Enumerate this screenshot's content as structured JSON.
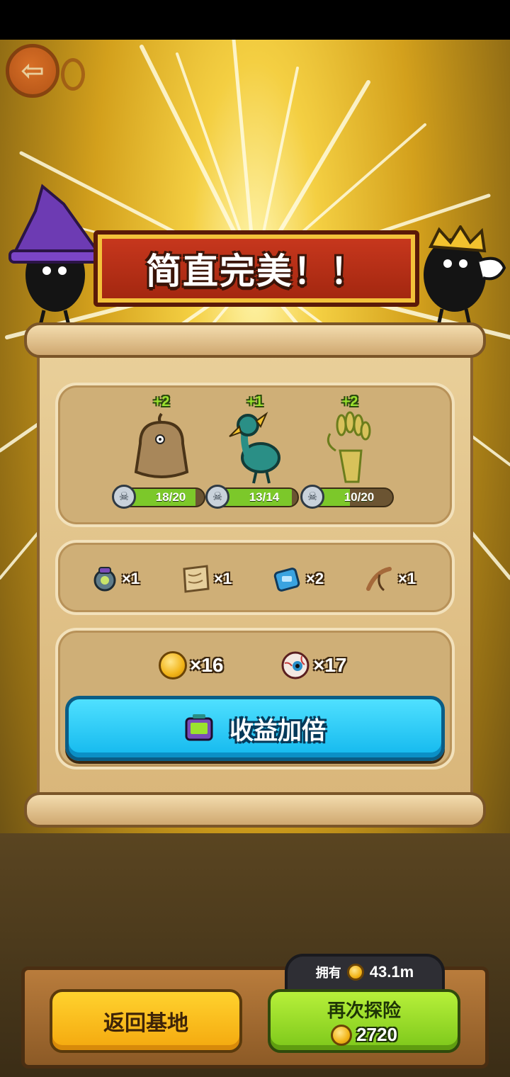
{
  "banner": {
    "title": "简直完美！！"
  },
  "units": [
    {
      "name_icon": "burlap-sack-monster-icon",
      "bonus": "+2",
      "progress": "18/20",
      "fraction": 0.9
    },
    {
      "name_icon": "teal-ostrich-bird-icon",
      "bonus": "+1",
      "progress": "13/14",
      "fraction": 0.93
    },
    {
      "name_icon": "wheat-bundle-creature-icon",
      "bonus": "+2",
      "progress": "10/20",
      "fraction": 0.5
    }
  ],
  "items": [
    {
      "icon": "tech-gadget-icon",
      "qty": "×1"
    },
    {
      "icon": "parchment-map-icon",
      "qty": "×1"
    },
    {
      "icon": "blue-device-icon",
      "qty": "×2"
    },
    {
      "icon": "slingshot-icon",
      "qty": "×1"
    }
  ],
  "currencies": [
    {
      "icon": "gold-coin-icon",
      "qty": "×16"
    },
    {
      "icon": "eyeball-icon",
      "qty": "×17"
    }
  ],
  "double_button": {
    "label": "收益加倍",
    "icon": "tv-ad-icon"
  },
  "footer": {
    "owned_label": "拥有",
    "owned_value": "43.1m",
    "return_label": "返回基地",
    "again_label": "再次探险",
    "again_cost": "2720"
  },
  "colors": {
    "accent_blue": "#13b8ee",
    "accent_green": "#7cc71a",
    "accent_yellow": "#f4a80e",
    "banner_red": "#c9381e"
  }
}
